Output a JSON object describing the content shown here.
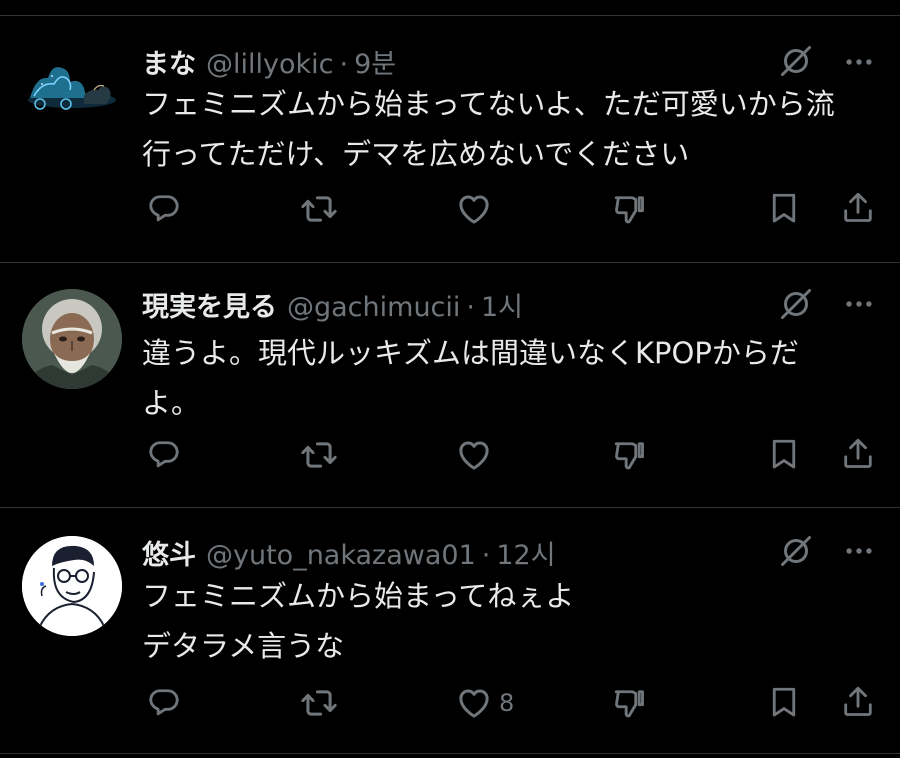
{
  "tweets": [
    {
      "name": "まな",
      "handle": "@lillyokic",
      "separator": "·",
      "time": "9분",
      "text": "フェミニズムから始まってないよ、ただ可愛いから流\n行ってただけ、デマを広めないでください",
      "like_count": ""
    },
    {
      "name": "現実を見る",
      "handle": "@gachimucii",
      "separator": "·",
      "time": "1시",
      "text": "違うよ。現代ルッキズムは間違いなくKPOPからだ\nよ。",
      "like_count": ""
    },
    {
      "name": "悠斗",
      "handle": "@yuto_nakazawa01",
      "separator": "·",
      "time": "12시",
      "text": "フェミニズムから始まってねぇよ\nデタラメ言うな",
      "like_count": "8"
    }
  ],
  "icons": {
    "reply": "reply-icon",
    "retweet": "retweet-icon",
    "like": "heart-icon",
    "dislike": "thumbs-down-icon",
    "bookmark": "bookmark-icon",
    "share": "share-icon",
    "grok": "grok-icon",
    "more": "more-icon"
  },
  "colors": {
    "background": "#000000",
    "text_primary": "#e7e9ea",
    "text_secondary": "#71767b",
    "divider": "#2f3336"
  }
}
